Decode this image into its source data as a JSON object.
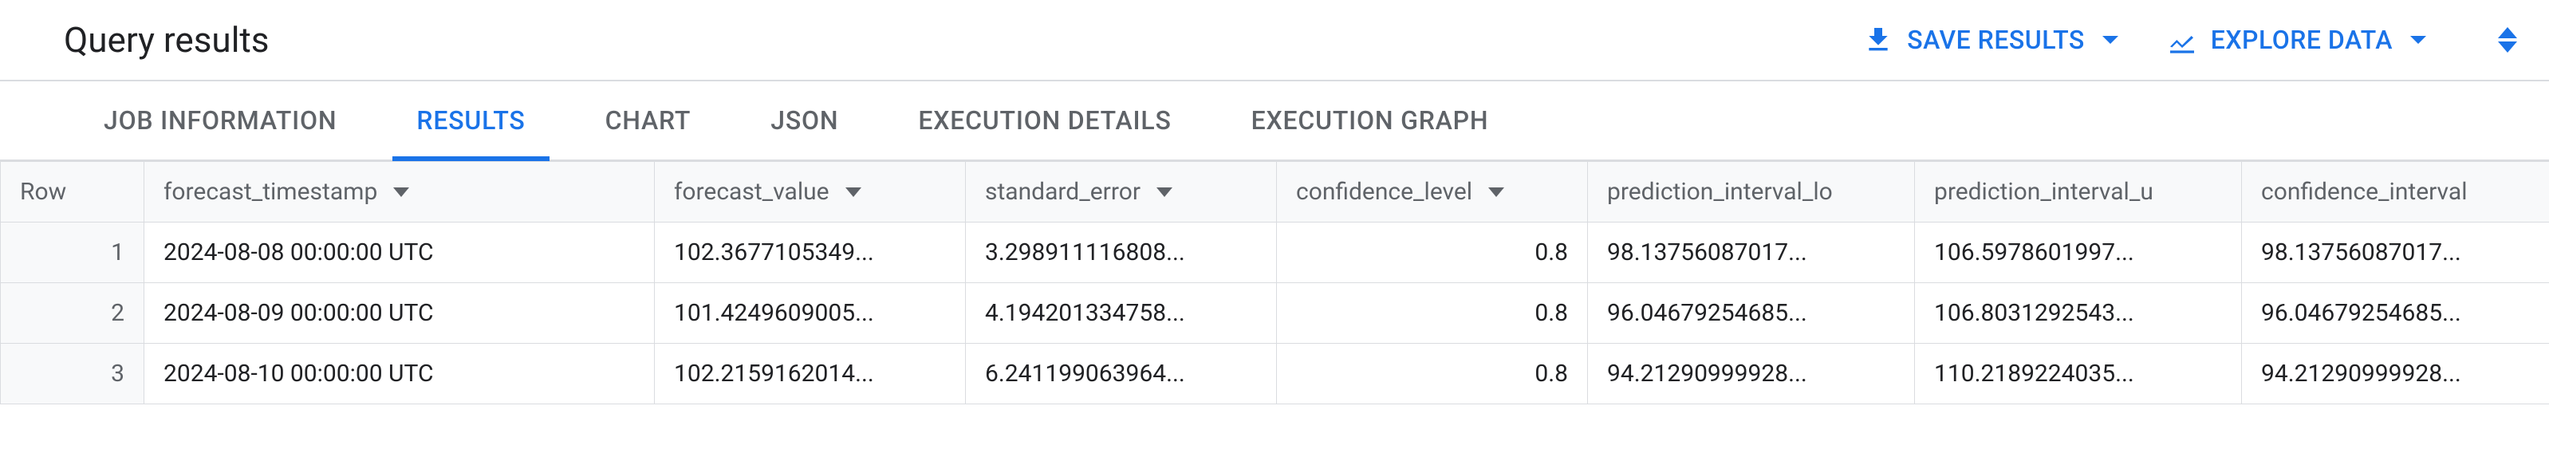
{
  "header": {
    "title": "Query results",
    "save_results": "SAVE RESULTS",
    "explore_data": "EXPLORE DATA"
  },
  "tabs": [
    {
      "label": "JOB INFORMATION",
      "active": false
    },
    {
      "label": "RESULTS",
      "active": true
    },
    {
      "label": "CHART",
      "active": false
    },
    {
      "label": "JSON",
      "active": false
    },
    {
      "label": "EXECUTION DETAILS",
      "active": false
    },
    {
      "label": "EXECUTION GRAPH",
      "active": false
    }
  ],
  "columns": {
    "row": "Row",
    "forecast_timestamp": "forecast_timestamp",
    "forecast_value": "forecast_value",
    "standard_error": "standard_error",
    "confidence_level": "confidence_level",
    "prediction_interval_lo": "prediction_interval_lo",
    "prediction_interval_u": "prediction_interval_u",
    "confidence_interval": "confidence_interval"
  },
  "rows": [
    {
      "row": "1",
      "forecast_timestamp": "2024-08-08 00:00:00 UTC",
      "forecast_value": "102.3677105349...",
      "standard_error": "3.298911116808...",
      "confidence_level": "0.8",
      "prediction_interval_lo": "98.13756087017...",
      "prediction_interval_u": "106.5978601997...",
      "confidence_interval": "98.13756087017..."
    },
    {
      "row": "2",
      "forecast_timestamp": "2024-08-09 00:00:00 UTC",
      "forecast_value": "101.4249609005...",
      "standard_error": "4.194201334758...",
      "confidence_level": "0.8",
      "prediction_interval_lo": "96.04679254685...",
      "prediction_interval_u": "106.8031292543...",
      "confidence_interval": "96.04679254685..."
    },
    {
      "row": "3",
      "forecast_timestamp": "2024-08-10 00:00:00 UTC",
      "forecast_value": "102.2159162014...",
      "standard_error": "6.241199063964...",
      "confidence_level": "0.8",
      "prediction_interval_lo": "94.21290999928...",
      "prediction_interval_u": "110.2189224035...",
      "confidence_interval": "94.21290999928..."
    }
  ]
}
